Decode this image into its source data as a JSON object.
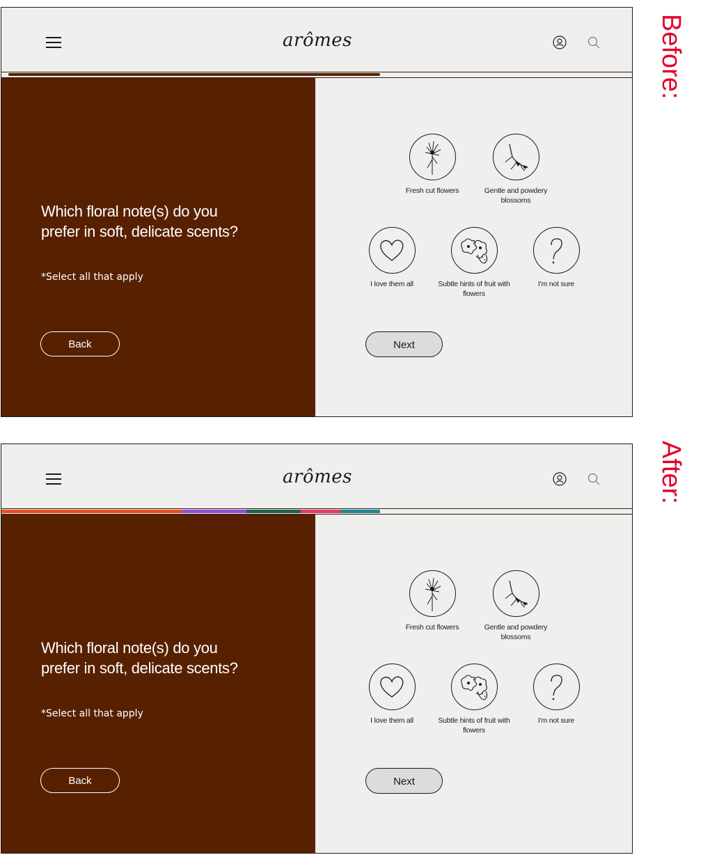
{
  "labels": {
    "before": "Before:",
    "after": "After:"
  },
  "header": {
    "logo": "arômes",
    "menu_icon": "hamburger-menu-icon",
    "account_icon": "user-icon",
    "search_icon": "search-icon"
  },
  "question": {
    "title": "Which floral note(s) do you prefer in soft, delicate scents?",
    "hint": "*Select all that apply"
  },
  "options": [
    {
      "label": "Fresh cut flowers",
      "icon": "flower-stem-icon"
    },
    {
      "label": "Gentle and powdery blossoms",
      "icon": "blossom-branch-icon"
    },
    {
      "label": "I love them all",
      "icon": "heart-icon"
    },
    {
      "label": "Subtle hints of fruit with flowers",
      "icon": "fruit-flower-icon"
    },
    {
      "label": "I'm not sure",
      "icon": "question-mark-icon"
    }
  ],
  "buttons": {
    "back": "Back",
    "next": "Next"
  },
  "progress": {
    "fraction": 0.6,
    "before_color": "#572101",
    "after_colors": [
      "#e8501f",
      "#8e4fd8",
      "#1e6650",
      "#e23b6a",
      "#1d8a9a"
    ]
  },
  "colors": {
    "panel": "#572101",
    "background": "#efefed",
    "accent_label": "#e4002b"
  }
}
